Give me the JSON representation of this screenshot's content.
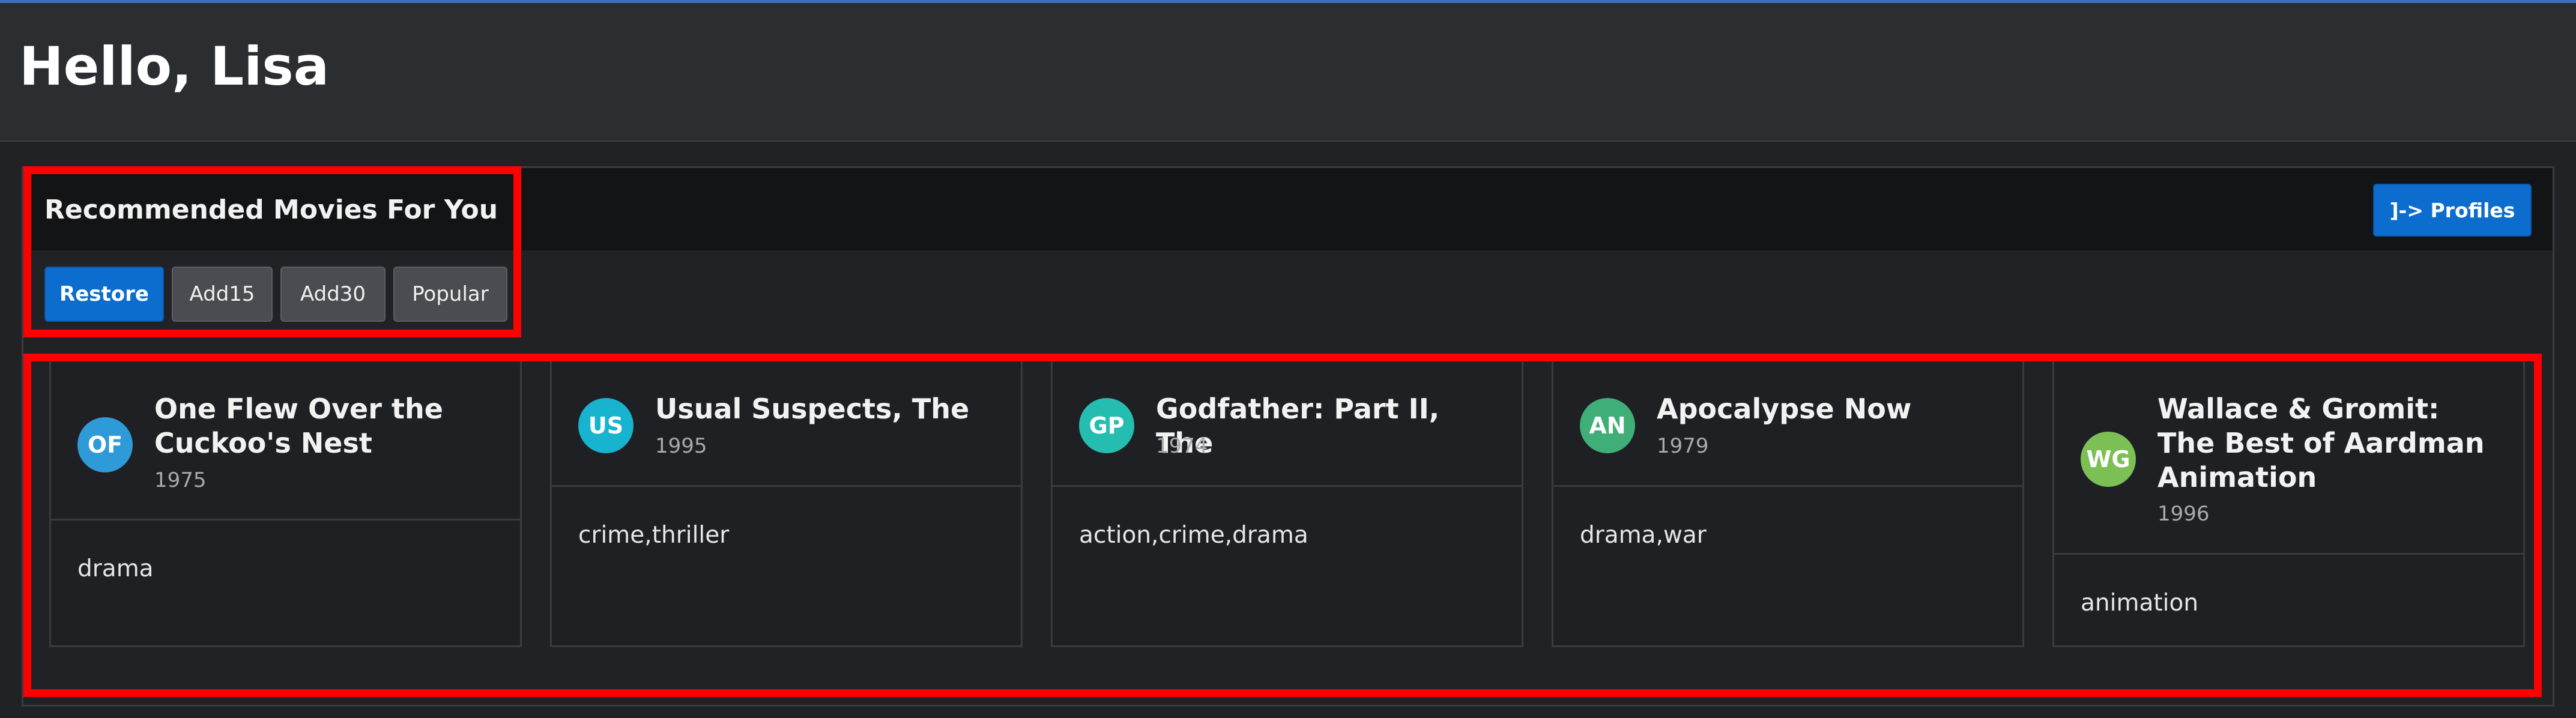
{
  "header": {
    "greeting": "Hello, Lisa"
  },
  "recommendations": {
    "title": "Recommended Movies For You",
    "profiles_button": "]-> Profiles",
    "buttons": [
      {
        "label": "Restore",
        "style": "primary"
      },
      {
        "label": "Add15",
        "style": "secondary"
      },
      {
        "label": "Add30",
        "style": "secondary"
      },
      {
        "label": "Popular",
        "style": "secondary"
      }
    ],
    "movies": [
      {
        "initials": "OF",
        "title": "One Flew Over the Cuckoo's Nest",
        "year": "1975",
        "genres": "drama",
        "avatar_color": "#2e9ad8"
      },
      {
        "initials": "US",
        "title": "Usual Suspects, The",
        "year": "1995",
        "genres": "crime,thriller",
        "avatar_color": "#17b3cf"
      },
      {
        "initials": "GP",
        "title": "Godfather: Part II, The",
        "year": "1974",
        "genres": "action,crime,drama",
        "avatar_color": "#24bdb0"
      },
      {
        "initials": "AN",
        "title": "Apocalypse Now",
        "year": "1979",
        "genres": "drama,war",
        "avatar_color": "#3fae79"
      },
      {
        "initials": "WG",
        "title": "Wallace & Gromit: The Best of Aardman Animation",
        "year": "1996",
        "genres": "animation",
        "avatar_color": "#7bbf55"
      }
    ]
  },
  "colors": {
    "accent": "#0d6dcf",
    "highlight": "#ff0000",
    "background": "#212226"
  }
}
